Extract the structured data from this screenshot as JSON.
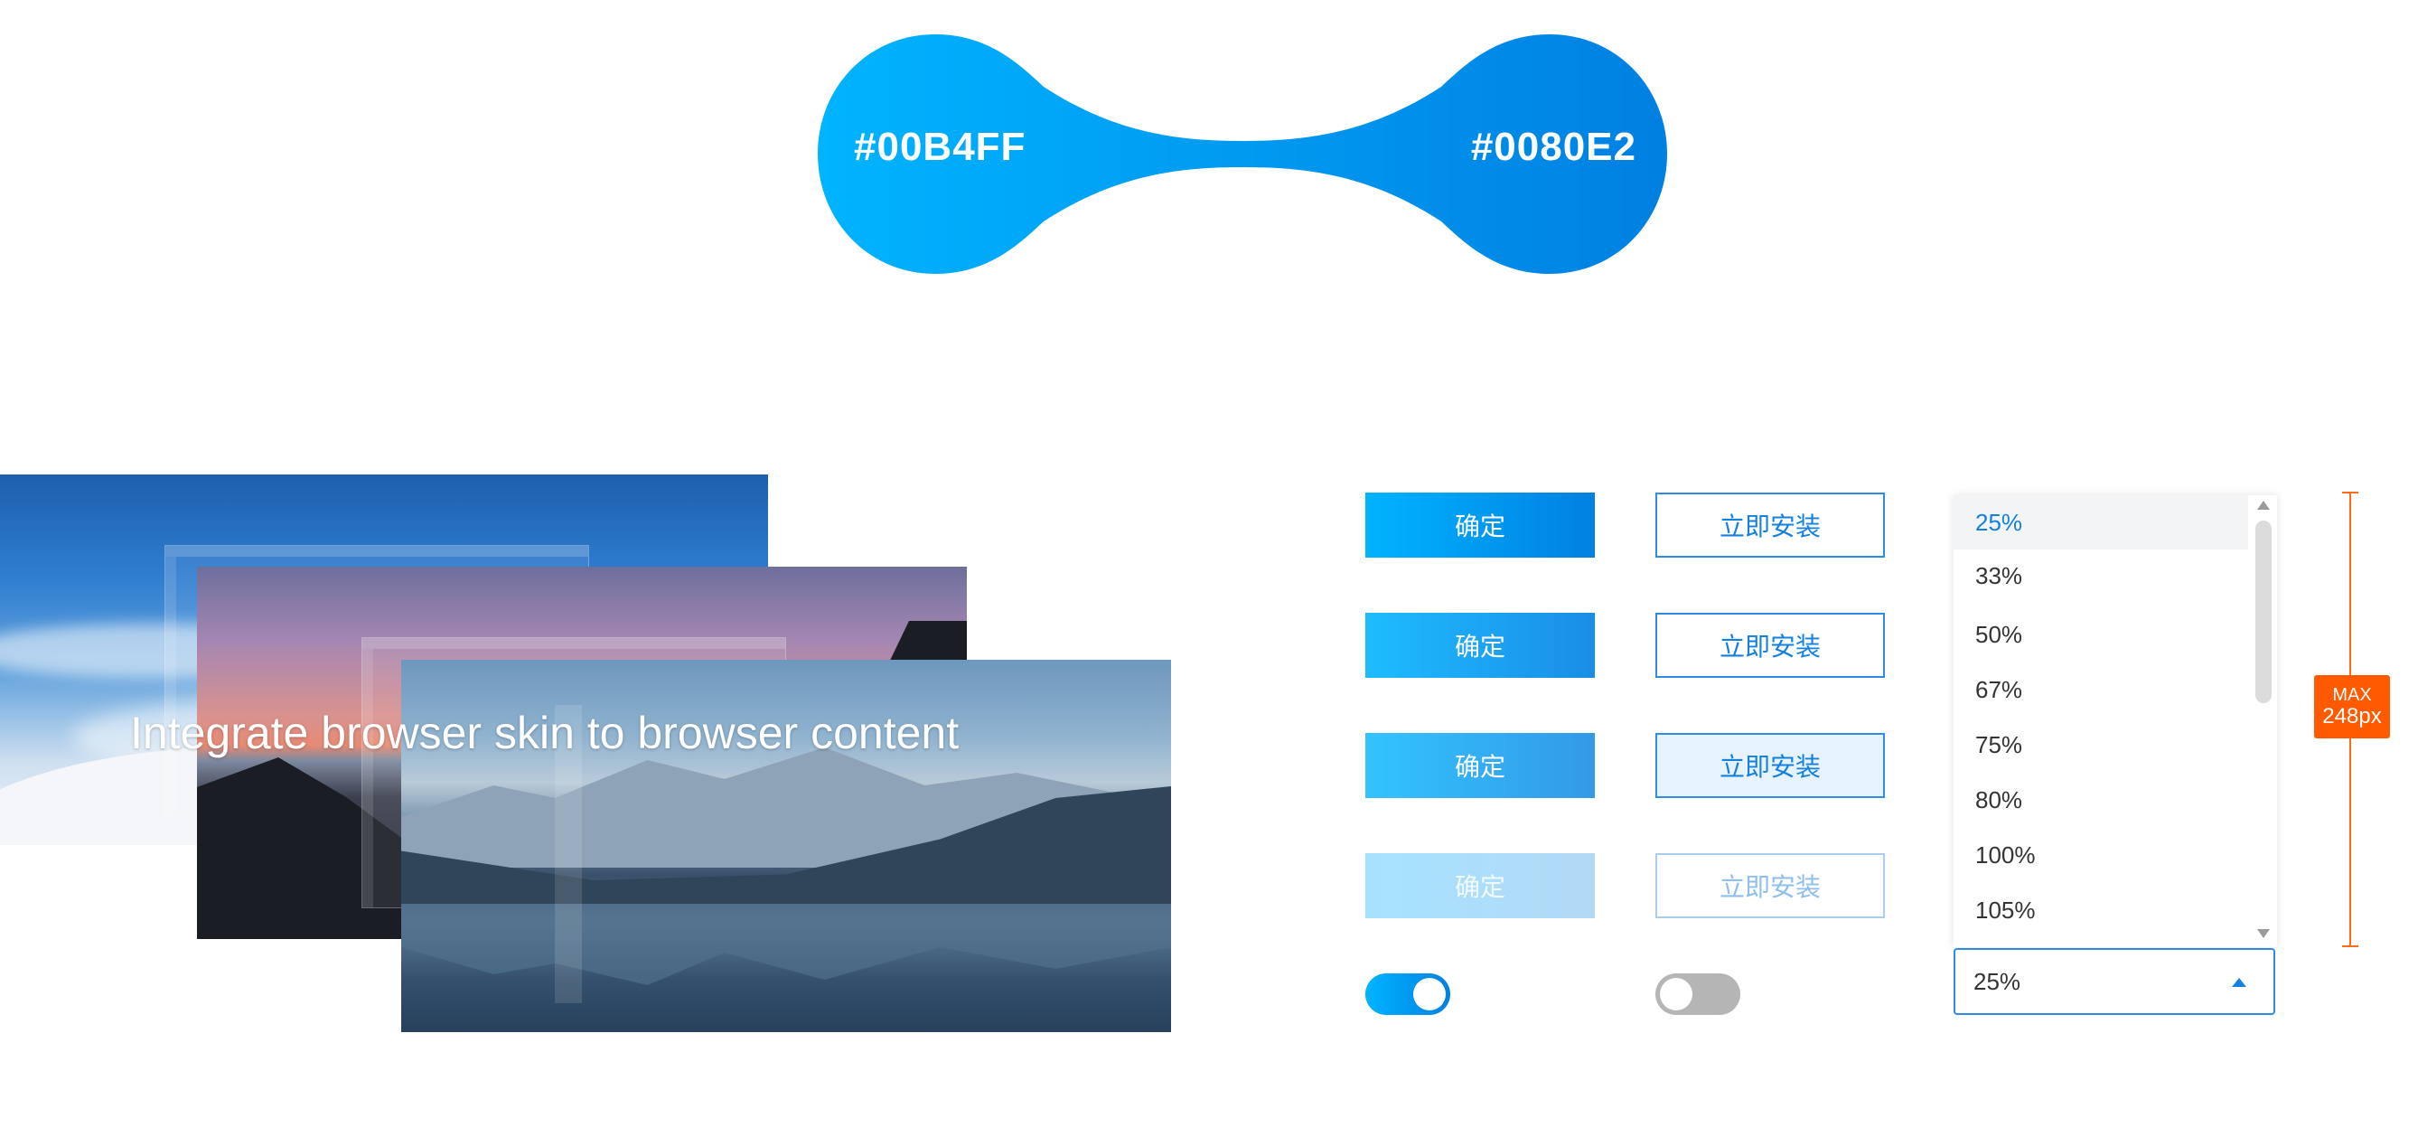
{
  "color_swatch": {
    "start_color": "#00B4FF",
    "end_color": "#0080E2",
    "start_label": "#00B4FF",
    "end_label": "#0080E2"
  },
  "skin_preview": {
    "tagline": "Integrate browser skin to browser content"
  },
  "buttons": {
    "primary": [
      {
        "state": "default",
        "label": "确定"
      },
      {
        "state": "hover",
        "label": "确定"
      },
      {
        "state": "pressed",
        "label": "确定"
      },
      {
        "state": "disabled",
        "label": "确定"
      }
    ],
    "outline": [
      {
        "state": "default",
        "label": "立即安装"
      },
      {
        "state": "hover",
        "label": "立即安装"
      },
      {
        "state": "pressed",
        "label": "立即安装"
      },
      {
        "state": "disabled",
        "label": "立即安装"
      }
    ]
  },
  "toggles": {
    "on": true,
    "off": false
  },
  "zoom_dropdown": {
    "options": [
      "25%",
      "33%",
      "50%",
      "67%",
      "75%",
      "80%",
      "100%",
      "105%"
    ],
    "selected": "25%",
    "value": "25%"
  },
  "annotation": {
    "line1": "MAX",
    "line2": "248px"
  },
  "colors": {
    "accent": "#0080E2",
    "accent_light": "#00B4FF",
    "annotation": "#FF5A00"
  }
}
